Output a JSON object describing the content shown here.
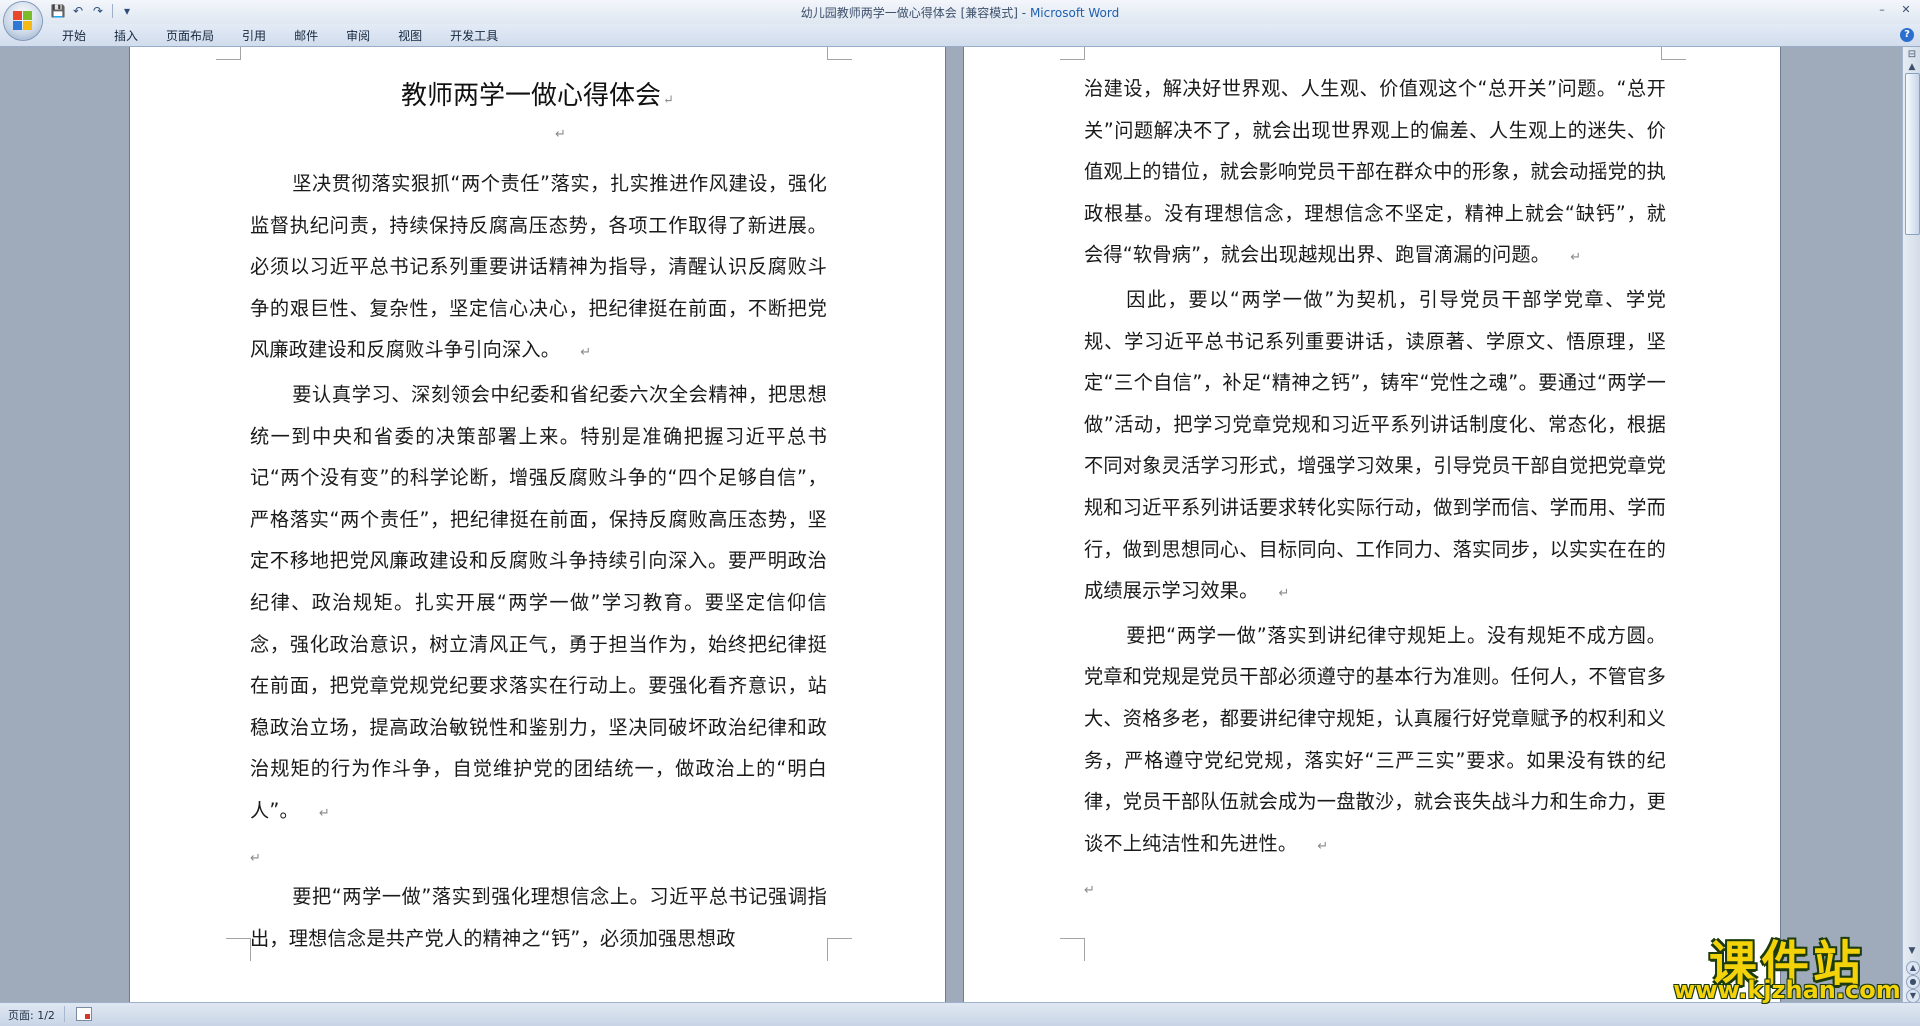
{
  "window": {
    "title_doc": "幼儿园教师两学一做心得体会 [兼容模式]",
    "title_sep": " - ",
    "title_app": "Microsoft Word",
    "minimize": "–",
    "close": "✕"
  },
  "qat": {
    "save": "💾",
    "undo": "↶",
    "redo": "↷",
    "more": "▾"
  },
  "ribbon": {
    "tabs": [
      "开始",
      "插入",
      "页面布局",
      "引用",
      "邮件",
      "审阅",
      "视图",
      "开发工具"
    ],
    "help": "?"
  },
  "document": {
    "title": "教师两学一做心得体会",
    "para_mark": "↵",
    "left_page": [
      "坚决贯彻落实狠抓“两个责任”落实，扎实推进作风建设，强化监督执纪问责，持续保持反腐高压态势，各项工作取得了新进展。必须以习近平总书记系列重要讲话精神为指导，清醒认识反腐败斗争的艰巨性、复杂性，坚定信心决心，把纪律挺在前面，不断把党风廉政建设和反腐败斗争引向深入。",
      "要认真学习、深刻领会中纪委和省纪委六次全会精神，把思想统一到中央和省委的决策部署上来。特别是准确把握习近平总书记“两个没有变”的科学论断，增强反腐败斗争的“四个足够自信”，严格落实“两个责任”，把纪律挺在前面，保持反腐败高压态势，坚定不移地把党风廉政建设和反腐败斗争持续引向深入。要严明政治纪律、政治规矩。扎实开展“两学一做”学习教育。要坚定信仰信念，强化政治意识，树立清风正气，勇于担当作为，始终把纪律挺在前面，把党章党规党纪要求落实在行动上。要强化看齐意识，站稳政治立场，提高政治敏锐性和鉴别力，坚决同破坏政治纪律和政治规矩的行为作斗争，自觉维护党的团结统一，做政治上的“明白人”。",
      "",
      "要把“两学一做”落实到强化理想信念上。习近平总书记强调指出，理想信念是共产党人的精神之“钙”，必须加强思想政"
    ],
    "right_page": [
      "治建设，解决好世界观、人生观、价值观这个“总开关”问题。“总开关”问题解决不了，就会出现世界观上的偏差、人生观上的迷失、价值观上的错位，就会影响党员干部在群众中的形象，就会动摇党的执政根基。没有理想信念，理想信念不坚定，精神上就会“缺钙”，就会得“软骨病”，就会出现越规出界、跑冒滴漏的问题。",
      "因此，要以“两学一做”为契机，引导党员干部学党章、学党规、学习近平总书记系列重要讲话，读原著、学原文、悟原理，坚定“三个自信”，补足“精神之钙”，铸牢“党性之魂”。要通过“两学一做”活动，把学习党章党规和习近平系列讲话制度化、常态化，根据不同对象灵活学习形式，增强学习效果，引导党员干部自觉把党章党规和习近平系列讲话要求转化实际行动，做到学而信、学而用、学而行，做到思想同心、目标同向、工作同力、落实同步，以实实在在的成绩展示学习效果。",
      "要把“两学一做”落实到讲纪律守规矩上。没有规矩不成方圆。党章和党规是党员干部必须遵守的基本行为准则。任何人，不管官多大、资格多老，都要讲纪律守规矩，认真履行好党章赋予的权利和义务，严格遵守党纪党规，落实好“三严三实”要求。如果没有铁的纪律，党员干部队伍就会成为一盘散沙，就会丧失战斗力和生命力，更谈不上纯洁性和先进性。",
      ""
    ]
  },
  "statusbar": {
    "page": "页面: 1/2"
  },
  "watermark": {
    "big": "课件站",
    "small": "www.kjzhan.com"
  },
  "colors": {
    "workspace": "#9fabbb",
    "app_title": "#1f5fb0",
    "watermark": "#f3d20a"
  }
}
